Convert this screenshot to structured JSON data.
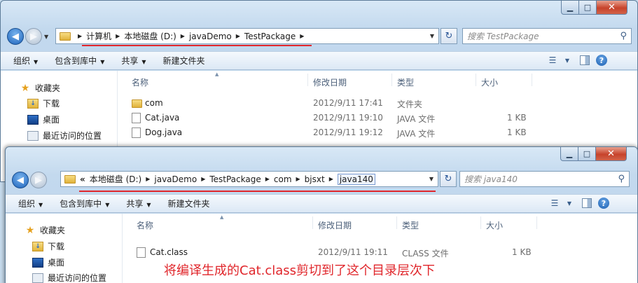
{
  "window1": {
    "address": {
      "crumbs": [
        "计算机",
        "本地磁盘 (D:)",
        "javaDemo",
        "TestPackage"
      ]
    },
    "search_placeholder": "搜索 TestPackage",
    "toolbar": {
      "organize": "组织",
      "include_library": "包含到库中",
      "share": "共享",
      "new_folder": "新建文件夹"
    },
    "nav": {
      "favorites": "收藏夹",
      "downloads": "下载",
      "desktop": "桌面",
      "recent": "最近访问的位置"
    },
    "columns": {
      "name": "名称",
      "modified": "修改日期",
      "type": "类型",
      "size": "大小"
    },
    "files": [
      {
        "name": "com",
        "modified": "2012/9/11 17:41",
        "type": "文件夹",
        "size": "",
        "icon": "folder"
      },
      {
        "name": "Cat.java",
        "modified": "2012/9/11 19:10",
        "type": "JAVA 文件",
        "size": "1 KB",
        "icon": "file"
      },
      {
        "name": "Dog.java",
        "modified": "2012/9/11 19:12",
        "type": "JAVA 文件",
        "size": "1 KB",
        "icon": "file"
      }
    ]
  },
  "window2": {
    "address": {
      "overflow": "«",
      "crumbs": [
        "本地磁盘 (D:)",
        "javaDemo",
        "TestPackage",
        "com",
        "bjsxt"
      ],
      "current": "java140"
    },
    "search_placeholder": "搜索 java140",
    "toolbar": {
      "organize": "组织",
      "include_library": "包含到库中",
      "share": "共享",
      "new_folder": "新建文件夹"
    },
    "nav": {
      "favorites": "收藏夹",
      "downloads": "下载",
      "desktop": "桌面",
      "recent": "最近访问的位置"
    },
    "columns": {
      "name": "名称",
      "modified": "修改日期",
      "type": "类型",
      "size": "大小"
    },
    "files": [
      {
        "name": "Cat.class",
        "modified": "2012/9/11 19:11",
        "type": "CLASS 文件",
        "size": "1 KB",
        "icon": "file"
      }
    ]
  },
  "annotation": "将编译生成的Cat.class剪切到了这个目录层次下",
  "colors": {
    "annotation_red": "#e0262b",
    "window_chrome": "#c3d9ee"
  }
}
